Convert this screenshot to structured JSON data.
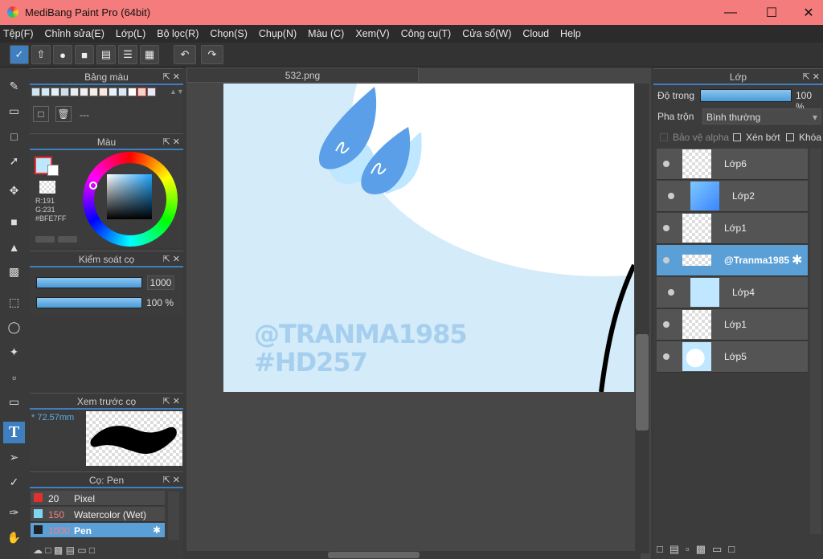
{
  "window": {
    "title": "MediBang Paint Pro (64bit)"
  },
  "menu": [
    "Tệp(F)",
    "Chỉnh sửa(E)",
    "Lớp(L)",
    "Bộ lọc(R)",
    "Chọn(S)",
    "Chụp(N)",
    "Màu (C)",
    "Xem(V)",
    "Công cụ(T)",
    "Cửa sổ(W)",
    "Cloud",
    "Help"
  ],
  "canvas": {
    "tab": "532.png",
    "watermark1": "@TRANMA1985",
    "watermark2": "#HD257"
  },
  "palette": {
    "title": "Bảng màu",
    "name": "---"
  },
  "color": {
    "title": "Màu",
    "r": "R:191",
    "g": "G:231",
    "hex": "#BFE7FF",
    "current": "#bfe7ff"
  },
  "brush_control": {
    "title": "Kiểm soát cọ",
    "size": "1000",
    "opacity": "100 %"
  },
  "brush_preview": {
    "title": "Xem trước cọ",
    "size": "* 72.57mm"
  },
  "brush_list": {
    "title": "Cọ: Pen",
    "items": [
      {
        "size": "20",
        "name": "Pixel",
        "color": "#e03030"
      },
      {
        "size": "150",
        "name": "Watercolor (Wet)",
        "color": "#7fd6f0"
      },
      {
        "size": "1000",
        "name": "Pen",
        "color": "#222222"
      }
    ]
  },
  "layers": {
    "title": "Lớp",
    "opacity_label": "Độ trong",
    "opacity_value": "100 %",
    "blend_label": "Pha trộn",
    "blend_value": "Bình thường",
    "protect_alpha": "Bảo vệ alpha",
    "clip": "Xén bớt",
    "lock": "Khóa",
    "items": [
      {
        "name": "Lớp6"
      },
      {
        "name": "Lớp2"
      },
      {
        "name": "Lớp1"
      },
      {
        "name": "@Tranma1985"
      },
      {
        "name": "Lớp4"
      },
      {
        "name": "Lớp1"
      },
      {
        "name": "Lớp5"
      }
    ]
  }
}
